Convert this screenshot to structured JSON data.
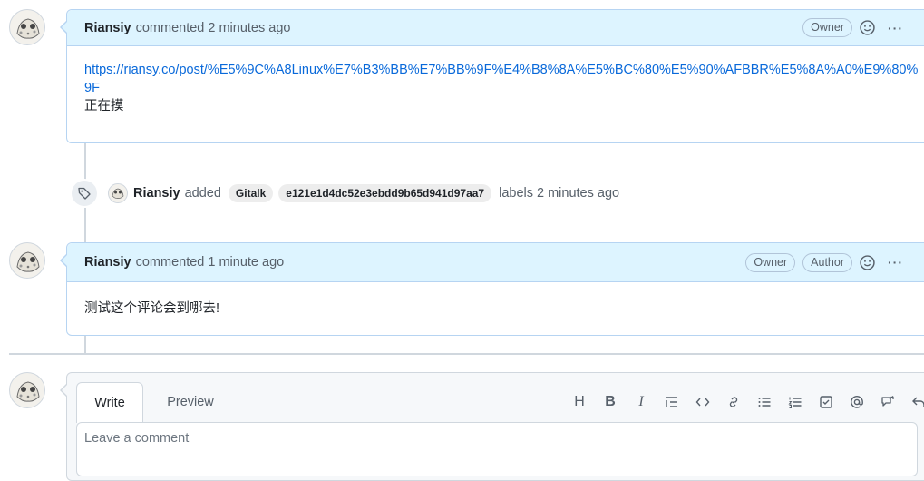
{
  "comments": [
    {
      "author": "Riansiy",
      "meta": "commented 2 minutes ago",
      "badges": [
        "Owner"
      ],
      "link": "https://riansy.co/post/%E5%9C%A8Linux%E7%B3%BB%E7%BB%9F%E4%B8%8A%E5%BC%80%E5%90%AFBBR%E5%8A%A0%E9%80%9F",
      "text": "正在摸"
    },
    {
      "author": "Riansiy",
      "meta": "commented 1 minute ago",
      "badges": [
        "Owner",
        "Author"
      ],
      "text": "测试这个评论会到哪去!"
    }
  ],
  "event": {
    "author": "Riansiy",
    "action": "added",
    "labels": [
      "Gitalk",
      "e121e1d4dc52e3ebdd9b65d941d97aa7"
    ],
    "suffix": "labels 2 minutes ago"
  },
  "editor": {
    "tabs": [
      "Write",
      "Preview"
    ],
    "toolbar": [
      "H",
      "B",
      "I",
      "☰",
      "<>",
      "🔗",
      "≡",
      "⋮≡",
      "☑",
      "@",
      "↗",
      "↩"
    ],
    "placeholder": "Leave a comment"
  },
  "colors": {
    "header_bg": "#ddf4ff",
    "border": "#b6d4f2",
    "link": "#0969da"
  }
}
